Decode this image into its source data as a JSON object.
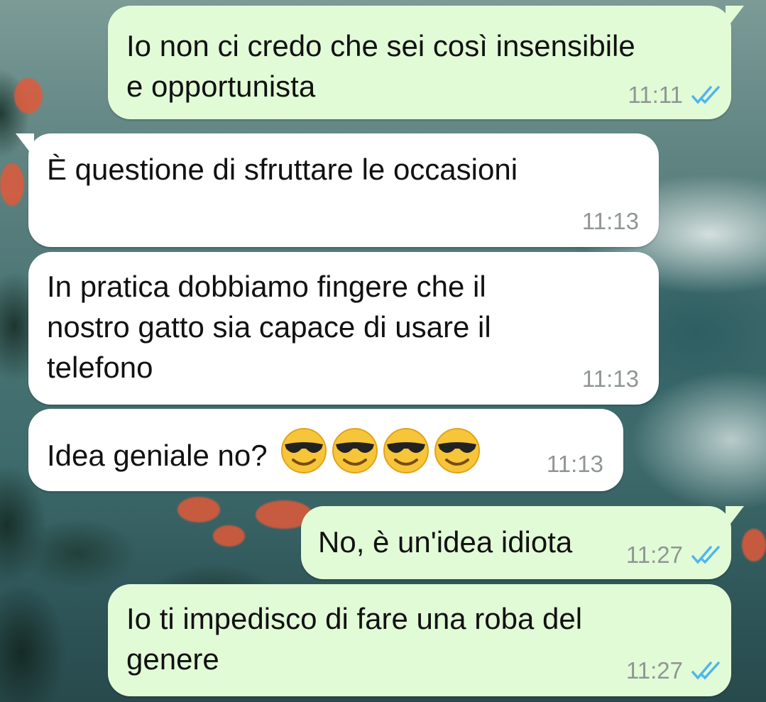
{
  "chat": {
    "messages": [
      {
        "direction": "outgoing",
        "lines": [
          "Io non ci credo che sei così insensibile",
          "e opportunista"
        ],
        "time": "11:11",
        "status": "read"
      },
      {
        "direction": "incoming",
        "lines": [
          "È questione di sfruttare le occasioni"
        ],
        "time": "11:13"
      },
      {
        "direction": "incoming",
        "lines": [
          "In pratica dobbiamo fingere che il",
          "nostro gatto sia capace di usare il",
          "telefono"
        ],
        "time": "11:13"
      },
      {
        "direction": "incoming",
        "lines": [
          "Idea geniale no?"
        ],
        "emoji": [
          "smiling-face-with-sunglasses",
          "smiling-face-with-sunglasses",
          "smiling-face-with-sunglasses",
          "smiling-face-with-sunglasses"
        ],
        "time": "11:13"
      },
      {
        "direction": "outgoing",
        "lines": [
          "No, è un'idea idiota"
        ],
        "time": "11:27",
        "status": "read"
      },
      {
        "direction": "outgoing",
        "lines": [
          "Io ti impedisco di fare una roba del",
          "genere"
        ],
        "time": "11:27",
        "status": "read"
      }
    ]
  },
  "colors": {
    "outgoing_bubble": "#e2fbd7",
    "incoming_bubble": "#ffffff",
    "read_tick": "#4fb6ec",
    "timestamp": "#8f9695"
  }
}
